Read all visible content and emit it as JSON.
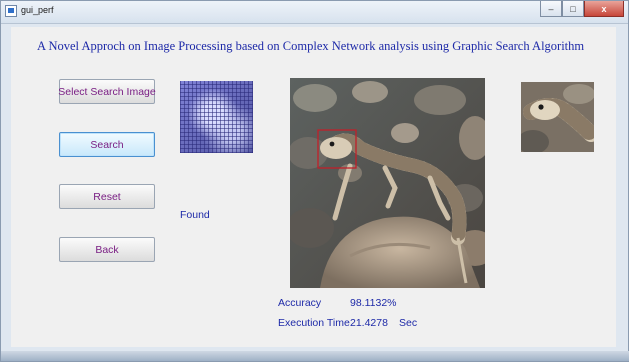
{
  "window": {
    "title": "gui_perf",
    "min_glyph": "–",
    "max_glyph": "□",
    "close_glyph": "x"
  },
  "header": {
    "title": "A Novel Approch on Image Processing based on Complex Network analysis using Graphic Search Algorithm"
  },
  "buttons": {
    "select": "Select Search Image",
    "search": "Search",
    "reset": "Reset",
    "back": "Back"
  },
  "status": {
    "found": "Found"
  },
  "metrics": {
    "accuracy_label": "Accuracy",
    "accuracy_value": "98.1132%",
    "time_label": "Execution Time",
    "time_value": "21.4278",
    "time_unit": "Sec"
  },
  "colors": {
    "accent_text": "#1e2aa8",
    "button_text": "#7a1f84",
    "selection_box": "#c0202a"
  }
}
